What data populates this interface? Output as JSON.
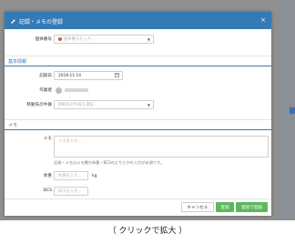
{
  "modal": {
    "title": "記録・メモの登録",
    "close": "×"
  },
  "fields": {
    "animal_id_label": "個体番号",
    "animal_id_placeholder": "個体番号を入力...",
    "basic_section": "基本情報",
    "record_date_label": "記録日",
    "record_date_value": "2018-11-14",
    "worker_label": "作業者",
    "target_label": "移動先の牛群",
    "target_placeholder": "移動先の牛群を選択...",
    "memo_section": "メモ",
    "memo_label": "メモ",
    "memo_placeholder": "メモを入力...",
    "help_text": "記録・メモはメモ欄か体重・BCSのどちらかの入力が必須です。",
    "weight_label": "体重",
    "weight_placeholder": "体重を入力...",
    "weight_unit": "kg",
    "bcs_label": "BCS",
    "bcs_placeholder": "BCSを入力..."
  },
  "buttons": {
    "cancel": "キャンセル",
    "save": "登録",
    "save_continue": "連続で登録"
  },
  "caption": "（ クリックで拡大 ）",
  "colors": {
    "header": "#337ab7",
    "save": "#5cb85c",
    "error": "#d9534f"
  },
  "icons": {
    "title": "pencil-icon",
    "date": "calendar-icon",
    "caret": "chevron-down-icon"
  }
}
